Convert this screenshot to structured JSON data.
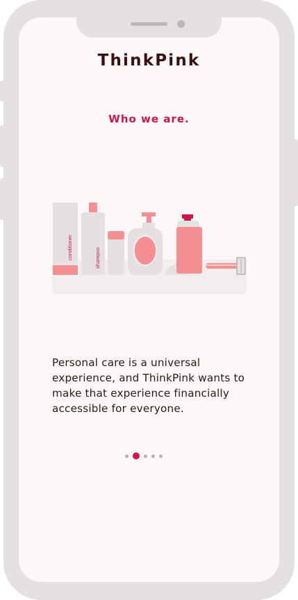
{
  "app": {
    "brand": "ThinkPink"
  },
  "screen": {
    "headline": "Who we are.",
    "body": "Personal care is a universal experience, and ThinkPink wants to make that experience financially accessible for everyone."
  },
  "illustration": {
    "labels": {
      "conditioner": "conditioner",
      "shampoo": "shampoo"
    },
    "colors": {
      "pink": "#f58f94",
      "light_gray": "#e6e1e1",
      "shelf": "#f2eeee",
      "accent": "#d1134e"
    }
  },
  "pagination": {
    "total": 5,
    "active_index": 1
  }
}
